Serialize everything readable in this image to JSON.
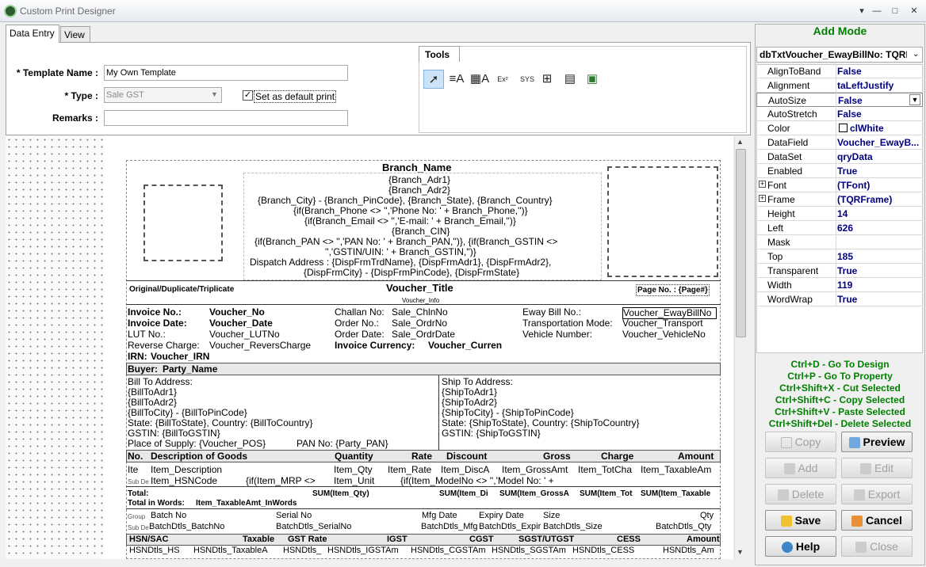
{
  "window": {
    "title": "Custom Print Designer",
    "min": "▾",
    "minimize": "—",
    "maximize": "□",
    "close": "✕"
  },
  "tabs": [
    "Data Entry",
    "View"
  ],
  "form": {
    "template_name_label": "* Template Name :",
    "template_name_value": "My Own Template",
    "type_label": "* Type :",
    "type_value": "Sale GST",
    "default_label": "Set as default print",
    "default_checked": "✓",
    "remarks_label": "Remarks :",
    "remarks_value": ""
  },
  "tools": {
    "title": "Tools",
    "items": [
      "select-arrow-icon",
      "label-tool-icon",
      "dbtext-tool-icon",
      "expression-tool-icon",
      "sysdata-tool-icon",
      "shape-tool-icon",
      "image-tool-icon",
      "dbimage-tool-icon"
    ]
  },
  "report": {
    "branch_name": "Branch_Name",
    "adr1": "{Branch_Adr1}",
    "adr2": "{Branch_Adr2}",
    "city_line": "{Branch_City} - {Branch_PinCode}, {Branch_State}, {Branch_Country}",
    "phone_line": "{if(Branch_Phone <> '','Phone No: ' + Branch_Phone,'')}",
    "email_line": "{if(Branch_Email <> '','E-mail: ' + Branch_Email,'')}",
    "cin": "{Branch_CIN}",
    "pan_line1": "{if(Branch_PAN <> '','PAN No: ' + Branch_PAN,'')}, {if(Branch_GSTIN <>",
    "pan_line2": "'','GSTIN/UIN: ' + Branch_GSTIN,'')}",
    "dispatch1": "Dispatch Address : {DispFrmTrdName}, {DispFrmAdr1}, {DispFrmAdr2},",
    "dispatch2": "{DispFrmCity} - {DispFrmPinCode}, {DispFrmState}",
    "orig": "Original/Duplicate/Triplicate",
    "voucher_title": "Voucher_Title",
    "voucher_info": "Voucher_Info",
    "page_no": "Page No. : {Page#}",
    "inv_no_l": "Invoice No.:",
    "inv_no_v": "Voucher_No",
    "inv_date_l": "Invoice Date:",
    "inv_date_v": "Voucher_Date",
    "lut_l": "LUT No.:",
    "lut_v": "Voucher_LUTNo",
    "rc_l": "Reverse Charge:",
    "rc_v": "Voucher_ReversCharge",
    "irn_l": "IRN:",
    "irn_v": "Voucher_IRN",
    "challan_l": "Challan No:",
    "challan_v": "Sale_ChlnNo",
    "order_l": "Order No.:",
    "order_v": "Sale_OrdrNo",
    "orderd_l": "Order Date:",
    "orderd_v": "Sale_OrdrDate",
    "cur_l": "Invoice Currency:",
    "cur_v": "Voucher_Curren",
    "eway_l": "Eway Bill No.:",
    "eway_v": "Voucher_EwayBillNo",
    "trans_l": "Transportation Mode:",
    "trans_v": "Voucher_Transport",
    "veh_l": "Vehicle Number:",
    "veh_v": "Voucher_VehicleNo",
    "buyer_l": "Buyer:",
    "buyer_v": "Party_Name",
    "bill": [
      "Bill To Address:",
      "{BillToAdr1}",
      "{BillToAdr2}",
      "{BillToCity} - {BillToPinCode}",
      "State: {BillToState}, Country: {BillToCountry}",
      "GSTIN: {BillToGSTIN}",
      "Place of Supply: {Voucher_POS}"
    ],
    "pan": "PAN No: {Party_PAN}",
    "ship": [
      "Ship To Address:",
      "{ShipToAdr1}",
      "{ShipToAdr2}",
      "{ShipToCity} - {ShipToPinCode}",
      "State: {ShipToState}, Country: {ShipToCountry}",
      "GSTIN: {ShipToGSTIN}"
    ],
    "cols": [
      "No.",
      "Description of Goods",
      "Quantity",
      "Rate",
      "Discount",
      "Gross",
      "Charge",
      "Amount"
    ],
    "row1": [
      "Ite",
      "Item_Description",
      "Item_Qty",
      "Item_Rate",
      "Item_DiscA",
      "Item_GrossAmt",
      "Item_TotCha",
      "Item_TaxableAm"
    ],
    "subdet": "Sub De",
    "row2": [
      "Item_HSNCode",
      "{if(Item_MRP <>",
      "Item_Unit",
      "{if(Item_ModelNo <> '','Model No: ' +"
    ],
    "total_l": "Total:",
    "total_q": "SUM(Item_Qty)",
    "total_d": "SUM(Item_Di",
    "total_g": "SUM(Item_GrossA",
    "total_c": "SUM(Item_Tot",
    "total_t": "SUM(Item_Taxable",
    "words_l": "Total in Words:",
    "words_v": "Item_TaxableAmt_InWords",
    "group": "Group",
    "batch_h": [
      "Batch No",
      "Serial No",
      "Mfg Date",
      "Expiry Date",
      "Size",
      "Qty"
    ],
    "batch_v": [
      "BatchDtls_BatchNo",
      "BatchDtls_SerialNo",
      "BatchDtls_Mfg",
      "BatchDtls_Expir",
      "BatchDtls_Size",
      "BatchDtls_Qty"
    ],
    "hsn_h": [
      "HSN/SAC",
      "Taxable",
      "GST Rate",
      "IGST",
      "CGST",
      "SGST/UTGST",
      "CESS",
      "Amount"
    ],
    "hsn_v": [
      "HSNDtls_HS",
      "HSNDtls_TaxableA",
      "HSNDtls_",
      "HSNDtls_IGSTAm",
      "HSNDtls_CGSTAm",
      "HSNDtls_SGSTAm",
      "HSNDtls_CESS",
      "HSNDtls_Am"
    ]
  },
  "inspector": {
    "mode": "Add Mode",
    "combo": "dbTxtVoucher_EwayBillNo: TQRDBText",
    "props": [
      [
        "AlignToBand",
        "False"
      ],
      [
        "Alignment",
        "taLeftJustify"
      ],
      [
        "AutoSize",
        "False"
      ],
      [
        "AutoStretch",
        "False"
      ],
      [
        "Color",
        "clWhite"
      ],
      [
        "DataField",
        "Voucher_EwayB..."
      ],
      [
        "DataSet",
        "qryData"
      ],
      [
        "Enabled",
        "True"
      ],
      [
        "Font",
        "(TFont)"
      ],
      [
        "Frame",
        "(TQRFrame)"
      ],
      [
        "Height",
        "14"
      ],
      [
        "Left",
        "626"
      ],
      [
        "Mask",
        ""
      ],
      [
        "Top",
        "185"
      ],
      [
        "Transparent",
        "True"
      ],
      [
        "Width",
        "119"
      ],
      [
        "WordWrap",
        "True"
      ]
    ],
    "shortcuts": [
      "Ctrl+D - Go To Design",
      "Ctrl+P - Go To Property",
      "Ctrl+Shift+X - Cut Selected",
      "Ctrl+Shift+C - Copy Selected",
      "Ctrl+Shift+V - Paste Selected",
      "Ctrl+Shift+Del - Delete Selected"
    ],
    "buttons": [
      "Copy",
      "Preview",
      "Add",
      "Edit",
      "Delete",
      "Export",
      "Save",
      "Cancel",
      "Help",
      "Close"
    ]
  }
}
